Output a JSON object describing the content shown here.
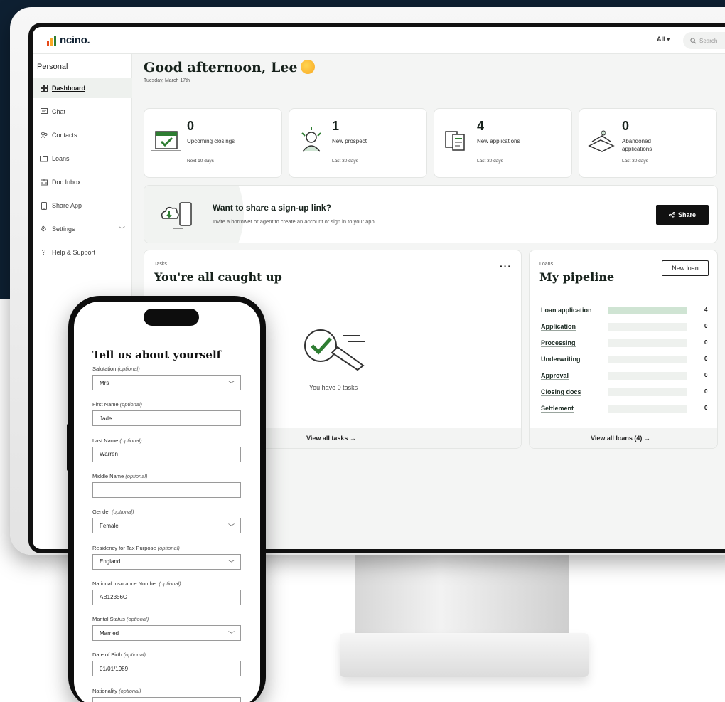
{
  "app": {
    "brand": "ncino.",
    "scope_filter": "All ▾",
    "search_placeholder": "Search"
  },
  "sidebar": {
    "heading": "Personal",
    "items": [
      {
        "label": "Dashboard",
        "icon": "dashboard-icon"
      },
      {
        "label": "Chat",
        "icon": "chat-icon"
      },
      {
        "label": "Contacts",
        "icon": "contacts-icon"
      },
      {
        "label": "Loans",
        "icon": "folder-icon"
      },
      {
        "label": "Doc Inbox",
        "icon": "inbox-icon"
      },
      {
        "label": "Share App",
        "icon": "phone-icon"
      },
      {
        "label": "Settings",
        "icon": "gear-icon"
      },
      {
        "label": "Help & Support",
        "icon": "help-icon"
      }
    ]
  },
  "greeting": {
    "title": "Good afternoon, Lee",
    "date": "Tuesday, March 17th"
  },
  "stats": [
    {
      "value": "0",
      "label": "Upcoming closings",
      "period": "Next 10 days",
      "icon": "calendar-check-icon"
    },
    {
      "value": "1",
      "label": "New prospect",
      "period": "Last 30 days",
      "icon": "celebrating-person-icon"
    },
    {
      "value": "4",
      "label": "New applications",
      "period": "Last 30 days",
      "icon": "documents-icon"
    },
    {
      "value": "0",
      "label": "Abandoned applications",
      "period": "Last 30 days",
      "icon": "abandoned-pile-icon"
    }
  ],
  "share": {
    "title": "Want to share a sign-up link?",
    "subtitle": "Invite a borrower or agent to create an account or sign in to your app",
    "button": "Share"
  },
  "tasks": {
    "kicker": "Tasks",
    "title": "You're all caught up",
    "empty_text": "You have 0 tasks",
    "footer_link": "View all tasks →"
  },
  "loans": {
    "kicker": "Loans",
    "title": "My pipeline",
    "new_button": "New loan",
    "footer_link": "View all loans (4) →",
    "pipeline": [
      {
        "stage": "Loan application",
        "count": 4
      },
      {
        "stage": "Application",
        "count": 0
      },
      {
        "stage": "Processing",
        "count": 0
      },
      {
        "stage": "Underwriting",
        "count": 0
      },
      {
        "stage": "Approval",
        "count": 0
      },
      {
        "stage": "Closing docs",
        "count": 0
      },
      {
        "stage": "Settlement",
        "count": 0
      }
    ]
  },
  "form": {
    "title": "Tell us about yourself",
    "optional": "(optional)",
    "fields": [
      {
        "label": "Salutation",
        "value": "Mrs",
        "type": "select"
      },
      {
        "label": "First Name",
        "value": "Jade",
        "type": "text"
      },
      {
        "label": "Last Name",
        "value": "Warren",
        "type": "text"
      },
      {
        "label": "Middle Name",
        "value": "",
        "type": "text"
      },
      {
        "label": "Gender",
        "value": "Female",
        "type": "select"
      },
      {
        "label": "Residency for Tax Purpose",
        "value": "England",
        "type": "select"
      },
      {
        "label": "National Insurance Number",
        "value": "AB12356C",
        "type": "text"
      },
      {
        "label": "Marital Status",
        "value": "Married",
        "type": "select"
      },
      {
        "label": "Date of Birth",
        "value": "01/01/1989",
        "type": "text"
      },
      {
        "label": "Nationality",
        "value": "",
        "type": "text"
      }
    ]
  }
}
